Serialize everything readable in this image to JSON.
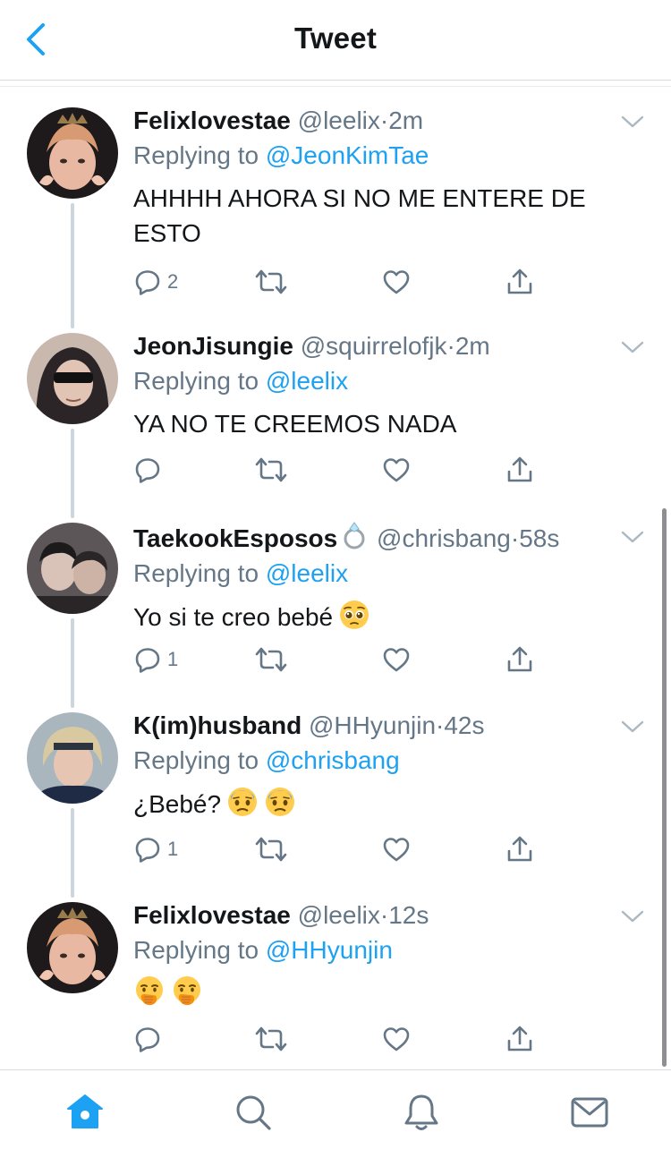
{
  "header": {
    "title": "Tweet",
    "back_icon": "chevron-left-icon"
  },
  "colors": {
    "accent": "#1da1f2",
    "secondary_text": "#657786",
    "connector": "#ccd6dd"
  },
  "tweets": [
    {
      "name": "Felixlovestae",
      "handle": "@leelix",
      "dot": "·",
      "time": "2m",
      "replying_prefix": "Replying to",
      "replying_to": "@JeonKimTae",
      "text": "AHHHH AHORA SI NO ME ENTERE DE ESTO",
      "reply_count": "2"
    },
    {
      "name": "JeonJisungie",
      "handle": "@squirrelofjk",
      "dot": "·",
      "time": "2m",
      "replying_prefix": "Replying to",
      "replying_to": "@leelix",
      "text": "YA NO TE CREEMOS NADA",
      "reply_count": ""
    },
    {
      "name": "TaekookEsposos",
      "name_emoji": "ring",
      "handle": "@chrisbang",
      "dot": "·",
      "time": "58s",
      "replying_prefix": "Replying to",
      "replying_to": "@leelix",
      "text": "Yo si te creo bebé",
      "text_emojis": [
        "pleading-face"
      ],
      "reply_count": "1"
    },
    {
      "name": "K(im)husband",
      "handle": "@HHyunjin",
      "dot": "·",
      "time": "42s",
      "replying_prefix": "Replying to",
      "replying_to": "@chrisbang",
      "text": "¿Bebé?",
      "text_emojis": [
        "fearful-face",
        "fearful-face"
      ],
      "reply_count": "1"
    },
    {
      "name": "Felixlovestae",
      "handle": "@leelix",
      "dot": "·",
      "time": "12s",
      "replying_prefix": "Replying to",
      "replying_to": "@HHyunjin",
      "text": "",
      "text_emojis": [
        "hand-over-mouth-face",
        "hand-over-mouth-face"
      ],
      "reply_count": ""
    }
  ],
  "tabbar": {
    "tabs": [
      "home-icon",
      "search-icon",
      "notifications-bell-icon",
      "messages-envelope-icon"
    ],
    "active": "home-icon"
  }
}
